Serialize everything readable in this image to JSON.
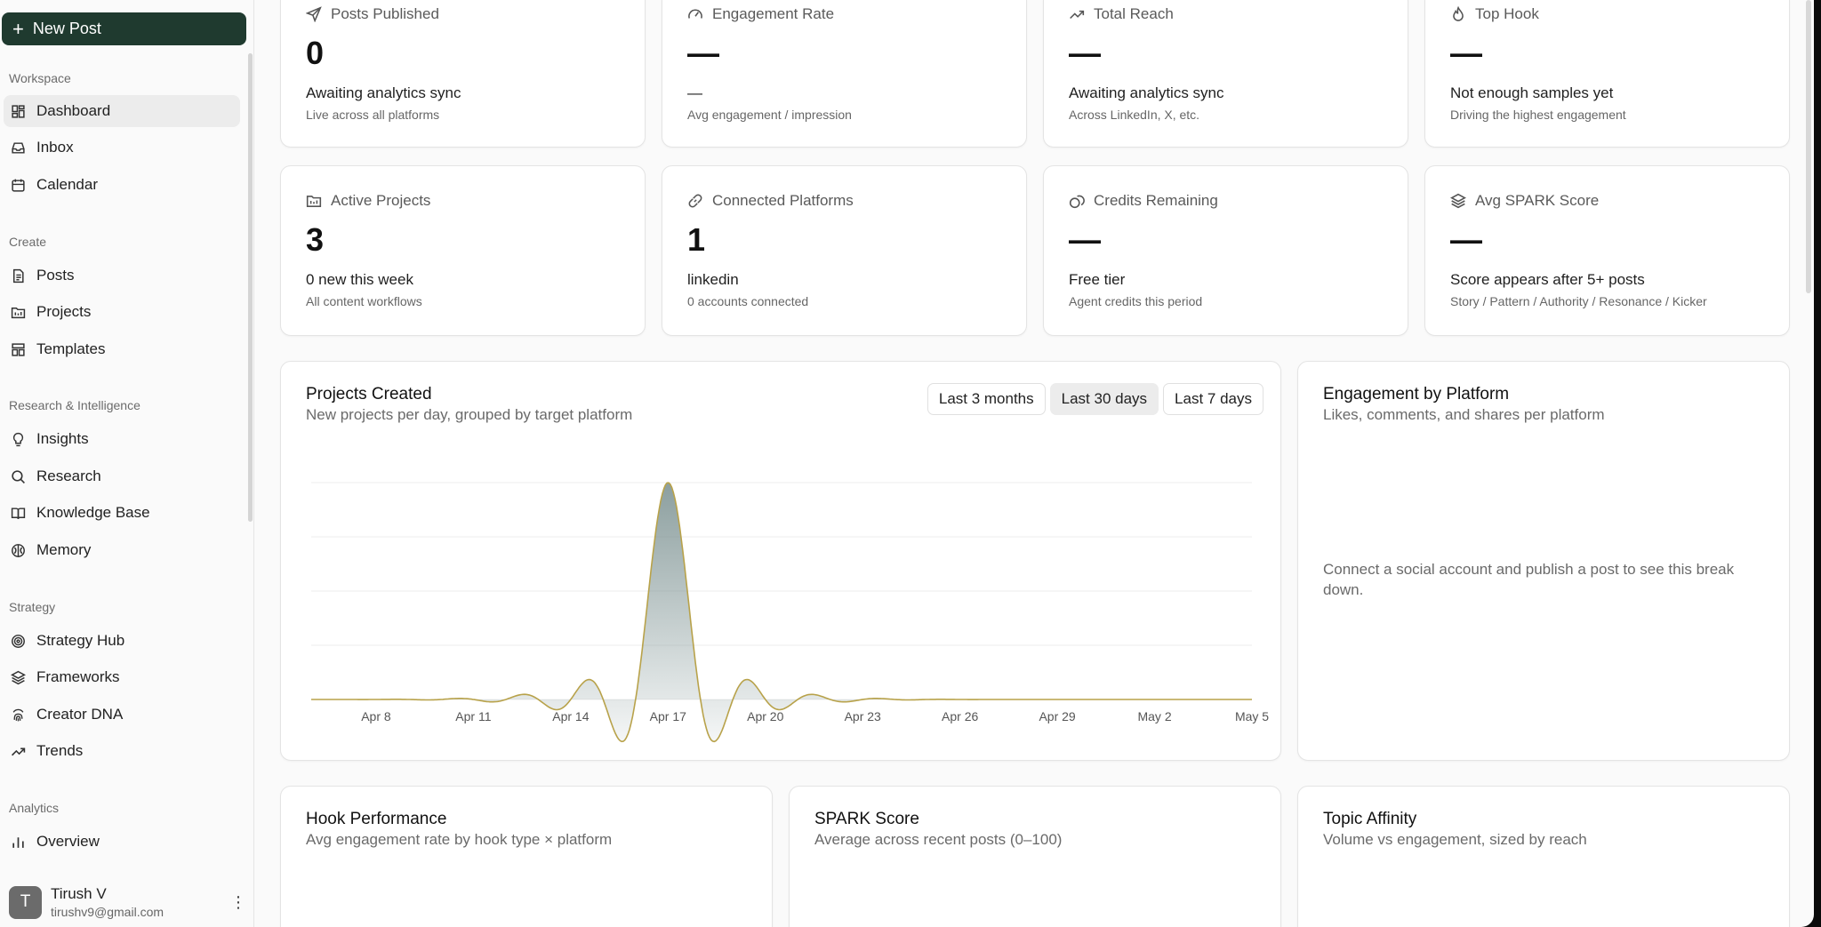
{
  "sidebar": {
    "new_post_label": "New Post",
    "sections": {
      "workspace": "Workspace",
      "create": "Create",
      "research": "Research & Intelligence",
      "strategy": "Strategy",
      "analytics": "Analytics"
    },
    "items": {
      "dashboard": "Dashboard",
      "inbox": "Inbox",
      "calendar": "Calendar",
      "posts": "Posts",
      "projects": "Projects",
      "templates": "Templates",
      "insights": "Insights",
      "research": "Research",
      "knowledge_base": "Knowledge Base",
      "memory": "Memory",
      "strategy_hub": "Strategy Hub",
      "frameworks": "Frameworks",
      "creator_dna": "Creator DNA",
      "trends": "Trends",
      "overview": "Overview"
    },
    "user": {
      "initial": "T",
      "name": "Tirush V",
      "email": "tirushv9@gmail.com"
    }
  },
  "stats": {
    "posts_published": {
      "label": "Posts Published",
      "value": "0",
      "line1": "Awaiting analytics sync",
      "line2": "Live across all platforms"
    },
    "engagement_rate": {
      "label": "Engagement Rate",
      "value": "—",
      "line1": "—",
      "line2": "Avg engagement / impression"
    },
    "total_reach": {
      "label": "Total Reach",
      "value": "—",
      "line1": "Awaiting analytics sync",
      "line2": "Across LinkedIn, X, etc."
    },
    "top_hook": {
      "label": "Top Hook",
      "value": "—",
      "line1": "Not enough samples yet",
      "line2": "Driving the highest engagement"
    },
    "active_projects": {
      "label": "Active Projects",
      "value": "3",
      "line1": "0 new this week",
      "line2": "All content workflows"
    },
    "connected_platforms": {
      "label": "Connected Platforms",
      "value": "1",
      "line1": "linkedin",
      "line2": "0 accounts connected"
    },
    "credits_remaining": {
      "label": "Credits Remaining",
      "value": "—",
      "line1": "Free tier",
      "line2": "Agent credits this period"
    },
    "avg_spark": {
      "label": "Avg SPARK Score",
      "value": "—",
      "line1": "Score appears after 5+ posts",
      "line2": "Story / Pattern / Authority / Resonance / Kicker"
    }
  },
  "projects_created": {
    "title": "Projects Created",
    "subtitle": "New projects per day, grouped by target platform",
    "ranges": [
      "Last 3 months",
      "Last 30 days",
      "Last 7 days"
    ],
    "selected_range": "Last 30 days"
  },
  "engagement_by_platform": {
    "title": "Engagement by Platform",
    "subtitle": "Likes, comments, and shares per platform",
    "empty": "Connect a social account and publish a post to see this break down."
  },
  "hook_performance": {
    "title": "Hook Performance",
    "subtitle": "Avg engagement rate by hook type × platform"
  },
  "spark_score": {
    "title": "SPARK Score",
    "subtitle": "Average across recent posts (0–100)"
  },
  "topic_affinity": {
    "title": "Topic Affinity",
    "subtitle": "Volume vs engagement, sized by reach"
  },
  "colors": {
    "primary": "#1f3a2f",
    "chart_line": "#b8a24a",
    "chart_fill": "#7f9494"
  },
  "chart_data": {
    "type": "area",
    "x": [
      "Apr 6",
      "Apr 7",
      "Apr 8",
      "Apr 9",
      "Apr 10",
      "Apr 11",
      "Apr 12",
      "Apr 13",
      "Apr 14",
      "Apr 15",
      "Apr 16",
      "Apr 17",
      "Apr 18",
      "Apr 19",
      "Apr 20",
      "Apr 21",
      "Apr 22",
      "Apr 23",
      "Apr 24",
      "Apr 25",
      "Apr 26",
      "Apr 27",
      "Apr 28",
      "Apr 29",
      "Apr 30",
      "May 1",
      "May 2",
      "May 3",
      "May 4",
      "May 5"
    ],
    "values": [
      0,
      0,
      0,
      0,
      0,
      0,
      0,
      0,
      0,
      0,
      0,
      3,
      0,
      0,
      0,
      0,
      0,
      0,
      0,
      0,
      0,
      0,
      0,
      0,
      0,
      0,
      0,
      0,
      0,
      0
    ],
    "tick_labels": [
      "Apr 8",
      "Apr 11",
      "Apr 14",
      "Apr 17",
      "Apr 20",
      "Apr 23",
      "Apr 26",
      "Apr 29",
      "May 2",
      "May 5"
    ],
    "xlabel": "",
    "ylabel": "",
    "ylim": [
      0,
      3
    ],
    "grid": true
  }
}
